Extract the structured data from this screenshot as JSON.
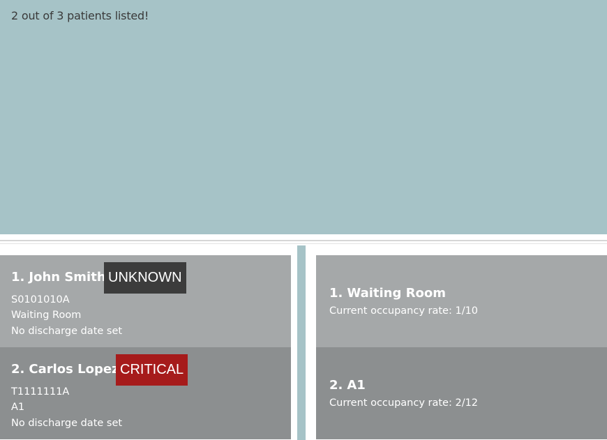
{
  "result_display": {
    "message": "2 out of 3 patients listed!"
  },
  "patients": [
    {
      "index": "1.",
      "name": "John Smith",
      "status": "UNKNOWN",
      "id": "S0101010A",
      "room": "Waiting Room",
      "discharge": "No discharge date set"
    },
    {
      "index": "2.",
      "name": "Carlos Lopez",
      "status": "CRITICAL",
      "id": "T1111111A",
      "room": "A1",
      "discharge": "No discharge date set"
    }
  ],
  "rooms": [
    {
      "index": "1.",
      "name": "Waiting Room",
      "occupancy": "Current occupancy rate: 1/10"
    },
    {
      "index": "2.",
      "name": "A1",
      "occupancy": "Current occupancy rate: 2/12"
    }
  ],
  "colors": {
    "background": "#a6c3c7",
    "card_light": "#a5a8a9",
    "card_dark": "#8c8f90",
    "tag_unknown": "#3c3c3c",
    "tag_critical": "#a61b1b"
  }
}
